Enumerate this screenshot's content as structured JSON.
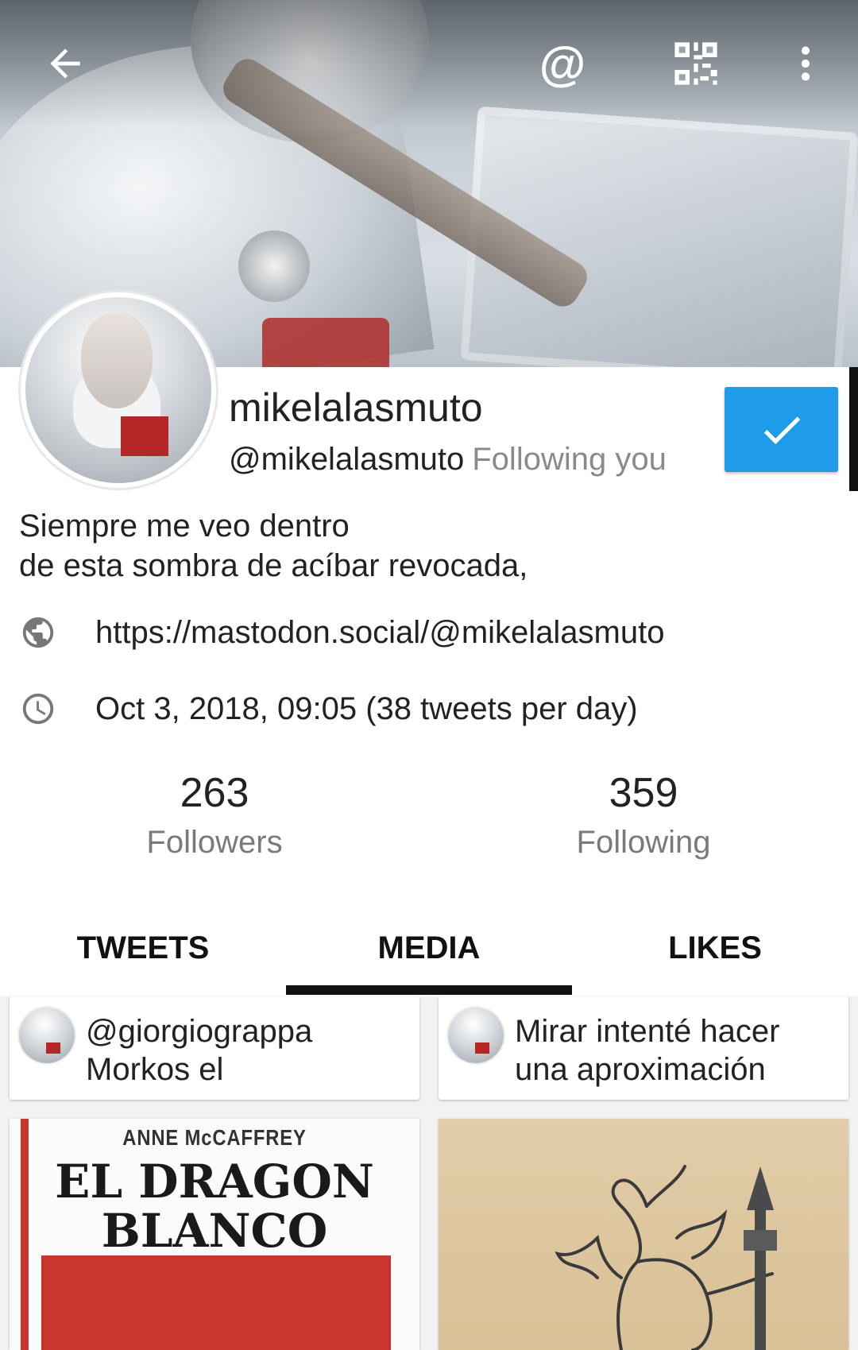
{
  "profile": {
    "display_name": "mikelalasmuto",
    "handle": "@mikelalasmuto",
    "follows_you": "Following you",
    "bio_line1": "Siempre me veo dentro",
    "bio_line2": "de esta sombra de acíbar revocada,",
    "url": "https://mastodon.social/@mikelalasmuto",
    "joined": "Oct 3, 2018, 09:05 (38 tweets per day)"
  },
  "stats": {
    "followers_count": "263",
    "followers_label": "Followers",
    "following_count": "359",
    "following_label": "Following"
  },
  "tabs": [
    {
      "label": "TWEETS"
    },
    {
      "label": "MEDIA",
      "active": true
    },
    {
      "label": "LIKES"
    }
  ],
  "media_cards": [
    {
      "text": "@giorgiograppa Morkos el"
    },
    {
      "text": "Mirar intenté hacer una aproximación"
    }
  ],
  "media_items": [
    {
      "author": "ANNE McCAFFREY",
      "title_line1": "EL DRAGON",
      "title_line2": "BLANCO"
    }
  ],
  "icons": {
    "back": "arrow-back-icon",
    "mention": "at-icon",
    "qr": "qr-code-icon",
    "more": "more-vert-icon",
    "web": "globe-icon",
    "clock": "clock-icon",
    "check": "check-icon"
  },
  "colors": {
    "accent": "#1e9be9",
    "text": "#222222",
    "secondary": "#8a8a8a"
  }
}
